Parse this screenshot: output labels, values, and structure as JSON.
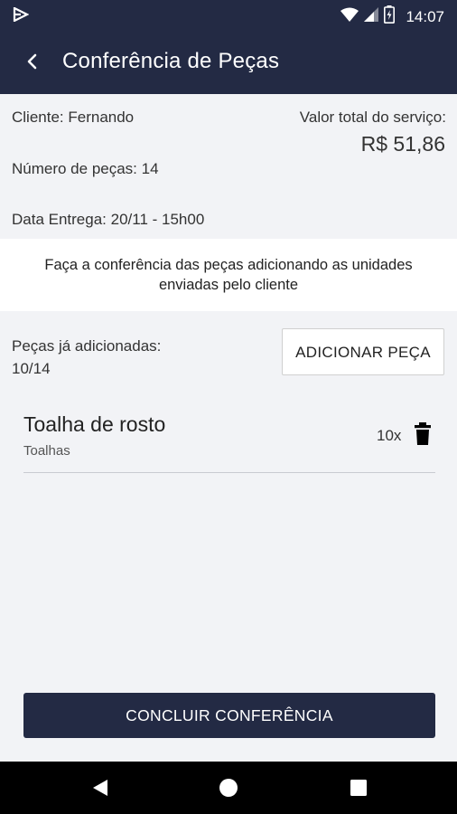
{
  "status_bar": {
    "time": "14:07",
    "icons": [
      "app-play-icon",
      "wifi-icon",
      "signal-icon",
      "battery-icon"
    ]
  },
  "app_bar": {
    "title": "Conferência de Peças",
    "back_icon": "back-chevron-icon"
  },
  "summary": {
    "client": "Cliente: Fernando",
    "pieces_count": "Número de peças: 14",
    "delivery_date": "Data Entrega: 20/11 - 15h00",
    "total_label": "Valor total do serviço:",
    "total_value": "R$ 51,86"
  },
  "instructions": "Faça a conferência das peças adicionando as unidades enviadas pelo cliente",
  "added": {
    "label_line1": "Peças já adicionadas:",
    "label_line2": "10/14",
    "add_button": "ADICIONAR PEÇA"
  },
  "items": [
    {
      "name": "Toalha de rosto",
      "category": "Toalhas",
      "quantity": "10x",
      "action_icon": "trash-icon"
    }
  ],
  "conclude_button": "CONCLUIR CONFERÊNCIA",
  "nav_bar": {
    "icons": [
      "back-triangle-icon",
      "home-circle-icon",
      "recents-square-icon"
    ]
  },
  "colors": {
    "primary": "#232a44",
    "background": "#f2f3f6",
    "surface": "#ffffff"
  }
}
